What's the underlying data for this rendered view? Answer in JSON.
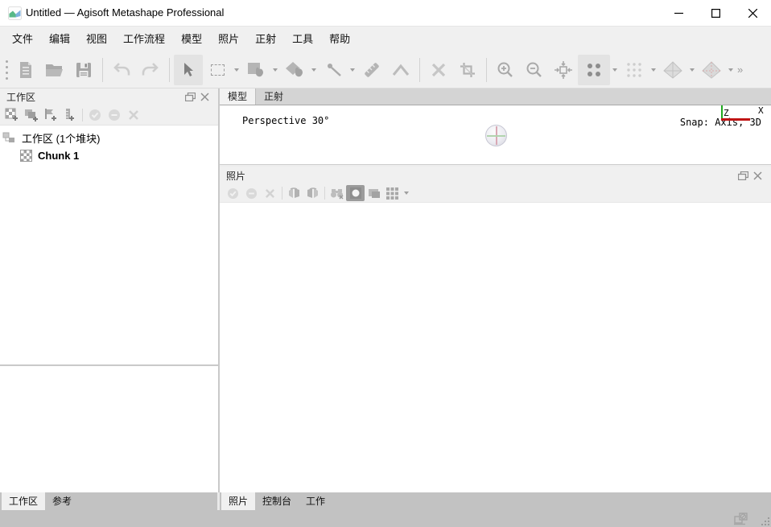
{
  "window": {
    "title": "Untitled — Agisoft Metashape Professional",
    "controls": [
      "minimize",
      "maximize",
      "close"
    ]
  },
  "menu": {
    "items": [
      "文件",
      "编辑",
      "视图",
      "工作流程",
      "模型",
      "照片",
      "正射",
      "工具",
      "帮助"
    ]
  },
  "toolbar": {
    "icons": [
      "drag-handle",
      "new-document",
      "open",
      "save",
      "undo",
      "redo",
      "select-arrow",
      "marquee-select",
      "move-region-tool",
      "move-object-tool",
      "draw-point-tool",
      "ruler-tool",
      "draw-polyline-tool",
      "delete",
      "crop-region",
      "zoom-in",
      "zoom-out",
      "fit-view",
      "point-cloud-view",
      "dense-cloud-view",
      "mesh-shaded-view",
      "mesh-textured-view",
      "overflow-chevron"
    ],
    "active_tools": [
      "select-arrow",
      "point-cloud-view"
    ],
    "overflow_glyph": "»"
  },
  "workspace": {
    "title": "工作区",
    "toolbar_icons": [
      "add-chunk",
      "add-photos",
      "add-marker",
      "add-scalebar",
      "enable-item",
      "disable-item",
      "remove-item"
    ],
    "tree": [
      {
        "label": "工作区 (1个堆块)",
        "icon": "workspace-hierarchy"
      },
      {
        "label": "Chunk 1",
        "icon": "chunk-checkerboard"
      }
    ]
  },
  "model_view": {
    "tabs": [
      "模型",
      "正射"
    ],
    "active_tab": "模型",
    "perspective_label": "Perspective 30°",
    "snap_label": "Snap: Axis, 3D",
    "axis_z": "Z",
    "axis_x": "X"
  },
  "photos": {
    "title": "照片",
    "toolbar_icons": [
      "enable-camera",
      "disable-camera",
      "remove-camera",
      "rotate-left",
      "rotate-right",
      "filter-photos",
      "thumbnail-view",
      "details-view",
      "grid-view"
    ]
  },
  "bottom_tabs": {
    "left": [
      "工作区",
      "参考"
    ],
    "left_active": "工作区",
    "right": [
      "照片",
      "控制台",
      "工作"
    ],
    "right_active": "照片"
  },
  "colors": {
    "titlebar": "#ffffff",
    "chrome": "#f0f0f0",
    "tabbar_inactive": "#d4d4d4",
    "bottom_bar": "#c2c2c2",
    "viewport": "#ffffff",
    "axis_green": "#1faa1f",
    "axis_red": "#c01414",
    "logo_green": "#58b987",
    "logo_blue": "#7fb2de"
  }
}
